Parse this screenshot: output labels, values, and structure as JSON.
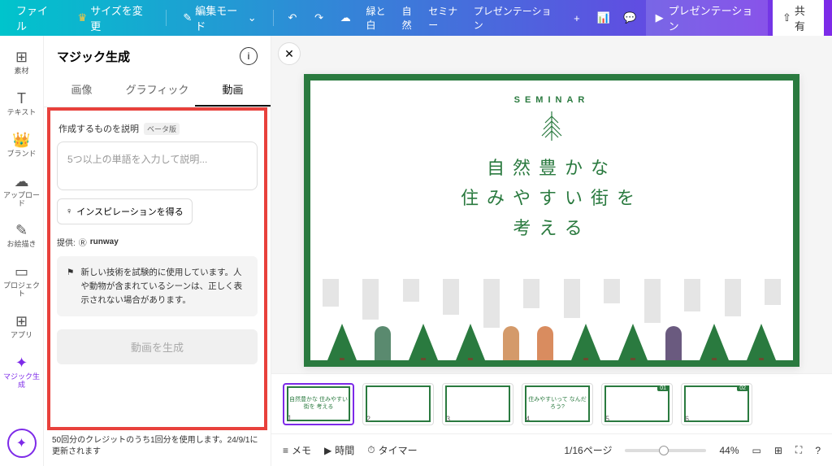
{
  "topbar": {
    "file": "ファイル",
    "resize": "サイズを変更",
    "edit_mode": "編集モード",
    "doc_title_parts": [
      "緑と白",
      "自然",
      "セミナー",
      "プレゼンテーション"
    ],
    "present": "プレゼンテーション",
    "share": "共有"
  },
  "rail": {
    "items": [
      {
        "icon": "⊞",
        "label": "素材"
      },
      {
        "icon": "T",
        "label": "テキスト"
      },
      {
        "icon": "👑",
        "label": "ブランド"
      },
      {
        "icon": "☁",
        "label": "アップロード"
      },
      {
        "icon": "✎",
        "label": "お絵描き"
      },
      {
        "icon": "▭",
        "label": "プロジェクト"
      },
      {
        "icon": "⊞",
        "label": "アプリ"
      }
    ],
    "magic": "マジック生成"
  },
  "panel": {
    "title": "マジック生成",
    "tabs": [
      "画像",
      "グラフィック",
      "動画"
    ],
    "active_tab": 2,
    "desc_label": "作成するものを説明",
    "beta": "ベータ版",
    "placeholder": "5つ以上の単語を入力して説明...",
    "inspiration": "インスピレーションを得る",
    "provider_label": "提供:",
    "provider_name": "runway",
    "notice": "新しい技術を試験的に使用しています。人や動物が含まれているシーンは、正しく表示されない場合があります。",
    "generate": "動画を生成",
    "credit": "50回分のクレジットのうち1回分を使用します。24/9/1に更新されます"
  },
  "slide": {
    "seminar": "SEMINAR",
    "line1": "自然豊かな",
    "line2": "住みやすい街を",
    "line3": "考える"
  },
  "thumbs": {
    "items": [
      {
        "num": "1",
        "tag": "",
        "text": "自然豊かな\n住みやすい街を\n考える"
      },
      {
        "num": "2",
        "tag": "",
        "text": ""
      },
      {
        "num": "3",
        "tag": "",
        "text": ""
      },
      {
        "num": "4",
        "tag": "",
        "text": "住みやすいって\nなんだろう?"
      },
      {
        "num": "5",
        "tag": "01",
        "text": ""
      },
      {
        "num": "6",
        "tag": "02",
        "text": ""
      }
    ]
  },
  "bottombar": {
    "memo": "メモ",
    "time": "時間",
    "timer": "タイマー",
    "page": "1/16ページ",
    "zoom": "44%"
  }
}
